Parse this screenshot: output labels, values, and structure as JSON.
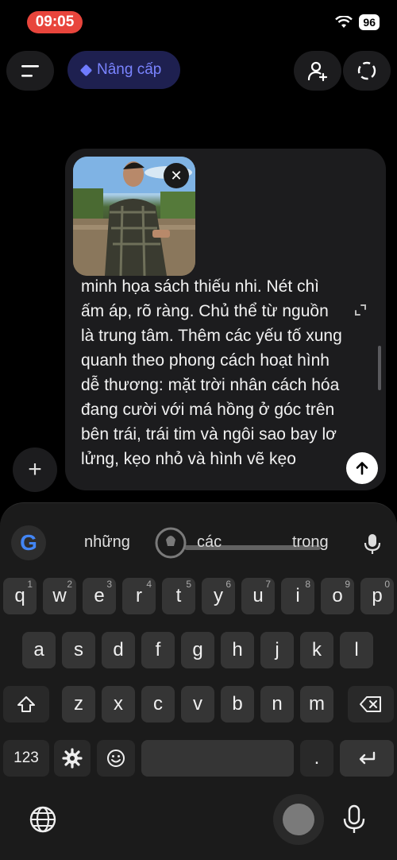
{
  "status": {
    "time": "09:05",
    "battery": "96"
  },
  "topbar": {
    "upgrade_label": "Nâng cấp"
  },
  "composer": {
    "prompt_text": "minh họa sách thiếu nhi. Nét chì ấm áp, rõ ràng. Chủ thể từ nguồn là trung tâm. Thêm các yếu tố xung quanh theo phong cách hoạt hình dễ thương: mặt trời nhân cách hóa đang cười với má hồng ở góc trên bên trái, trái tim và ngôi sao bay lơ lửng, kẹo nhỏ và hình vẽ kẹo"
  },
  "keyboard": {
    "suggestions": [
      "những",
      "các",
      "trong"
    ],
    "row1": [
      {
        "k": "q",
        "h": "1"
      },
      {
        "k": "w",
        "h": "2"
      },
      {
        "k": "e",
        "h": "3"
      },
      {
        "k": "r",
        "h": "4"
      },
      {
        "k": "t",
        "h": "5"
      },
      {
        "k": "y",
        "h": "6"
      },
      {
        "k": "u",
        "h": "7"
      },
      {
        "k": "i",
        "h": "8"
      },
      {
        "k": "o",
        "h": "9"
      },
      {
        "k": "p",
        "h": "0"
      }
    ],
    "row2": [
      "a",
      "s",
      "d",
      "f",
      "g",
      "h",
      "j",
      "k",
      "l"
    ],
    "row3": [
      "z",
      "x",
      "c",
      "v",
      "b",
      "n",
      "m"
    ],
    "numbers_label": "123",
    "period_label": "."
  }
}
